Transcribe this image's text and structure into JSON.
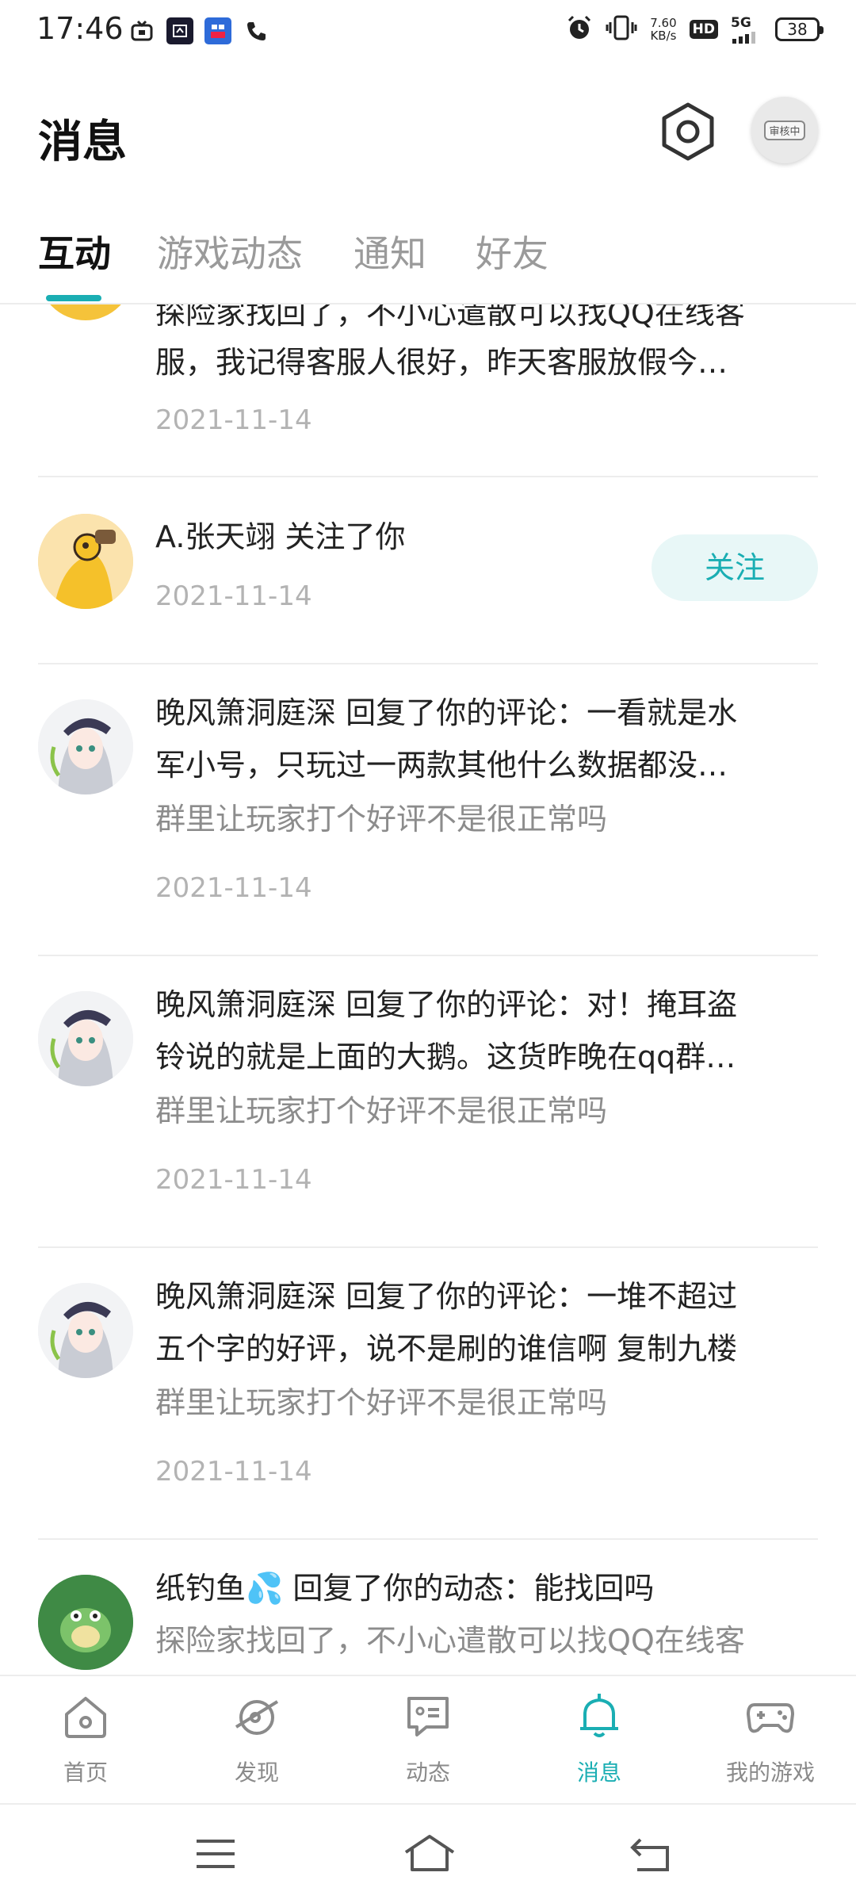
{
  "status_bar": {
    "time": "17:46",
    "speed_value": "7.60",
    "speed_unit": "KB/s",
    "hd": "HD",
    "network": "5G",
    "battery": "38",
    "icons": [
      "tv-icon",
      "app-icon",
      "zhihu-icon",
      "phone-icon",
      "alarm-icon",
      "vibrate-icon",
      "signal-icon"
    ]
  },
  "header": {
    "title": "消息",
    "avatar_badge": "审核中"
  },
  "tabs": [
    {
      "label": "互动",
      "active": true
    },
    {
      "label": "游戏动态",
      "active": false
    },
    {
      "label": "通知",
      "active": false
    },
    {
      "label": "好友",
      "active": false
    }
  ],
  "items": [
    {
      "line1": "探险家找回了，不小心遣散可以找QQ在线客",
      "line2": "服，我记得客服人很好，昨天客服放假今…",
      "date": "2021-11-14"
    },
    {
      "line1": "A.张天翊  关注了你",
      "date": "2021-11-14",
      "follow_label": "关注"
    },
    {
      "line1": "晚风箫洞庭深  回复了你的评论：一看就是水",
      "line2": "军小号，只玩过一两款其他什么数据都没…",
      "quote": "群里让玩家打个好评不是很正常吗",
      "date": "2021-11-14"
    },
    {
      "line1": "晚风箫洞庭深  回复了你的评论：对！掩耳盗",
      "line2": "铃说的就是上面的大鹅。这货昨晚在qq群…",
      "quote": "群里让玩家打个好评不是很正常吗",
      "date": "2021-11-14"
    },
    {
      "line1": "晚风箫洞庭深  回复了你的评论：一堆不超过",
      "line2": "五个字的好评，说不是刷的谁信啊  复制九楼",
      "quote": "群里让玩家打个好评不是很正常吗",
      "date": "2021-11-14"
    },
    {
      "line1": "纸钓鱼💦  回复了你的动态：能找回吗",
      "line2": "探险家找回了，不小心遣散可以找QQ在线客"
    }
  ],
  "bottom_nav": [
    {
      "label": "首页",
      "icon": "home-icon"
    },
    {
      "label": "发现",
      "icon": "discover-icon"
    },
    {
      "label": "动态",
      "icon": "feed-icon"
    },
    {
      "label": "消息",
      "icon": "bell-icon",
      "active": true
    },
    {
      "label": "我的游戏",
      "icon": "gamepad-icon"
    }
  ],
  "colors": {
    "accent": "#1aaeb3",
    "follow_bg": "#e8f7f7",
    "text_gray": "#8c8c8c",
    "date_gray": "#b3b3b3"
  }
}
